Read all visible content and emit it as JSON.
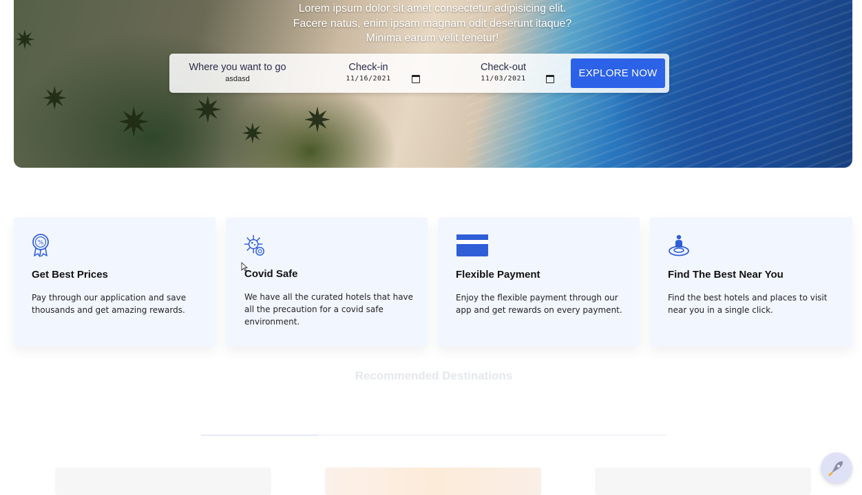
{
  "hero": {
    "text": "Lorem ipsum dolor sit amet consectetur adipisicing elit. Facere natus, enim ipsam magnam odit deserunt itaque? Minima earum velit tenetur!"
  },
  "search": {
    "where_label": "Where you want to go",
    "where_value": "asdasd",
    "checkin_label": "Check-in",
    "checkin_value": "11/16/2021",
    "checkout_label": "Check-out",
    "checkout_value": "11/03/2021",
    "explore_label": "EXPLORE NOW"
  },
  "features": [
    {
      "icon": "badge-percent-icon",
      "title": "Get Best Prices",
      "desc": "Pay through our application and save thousands and get amazing rewards."
    },
    {
      "icon": "virus-icon",
      "title": "Covid Safe",
      "desc": "We have all the curated hotels that have all the precaution for a covid safe environment."
    },
    {
      "icon": "credit-card-icon",
      "title": "Flexible Payment",
      "desc": "Enjoy the flexible payment through our app and get rewards on every payment."
    },
    {
      "icon": "location-person-icon",
      "title": "Find The Best Near You",
      "desc": "Find the best hotels and places to visit near you in a single click."
    }
  ],
  "recommended": {
    "title": "Recommended Destinations"
  },
  "colors": {
    "accent": "#2b62e8",
    "card_bg": "#f2f6ff",
    "icon": "#2f5ed6"
  }
}
